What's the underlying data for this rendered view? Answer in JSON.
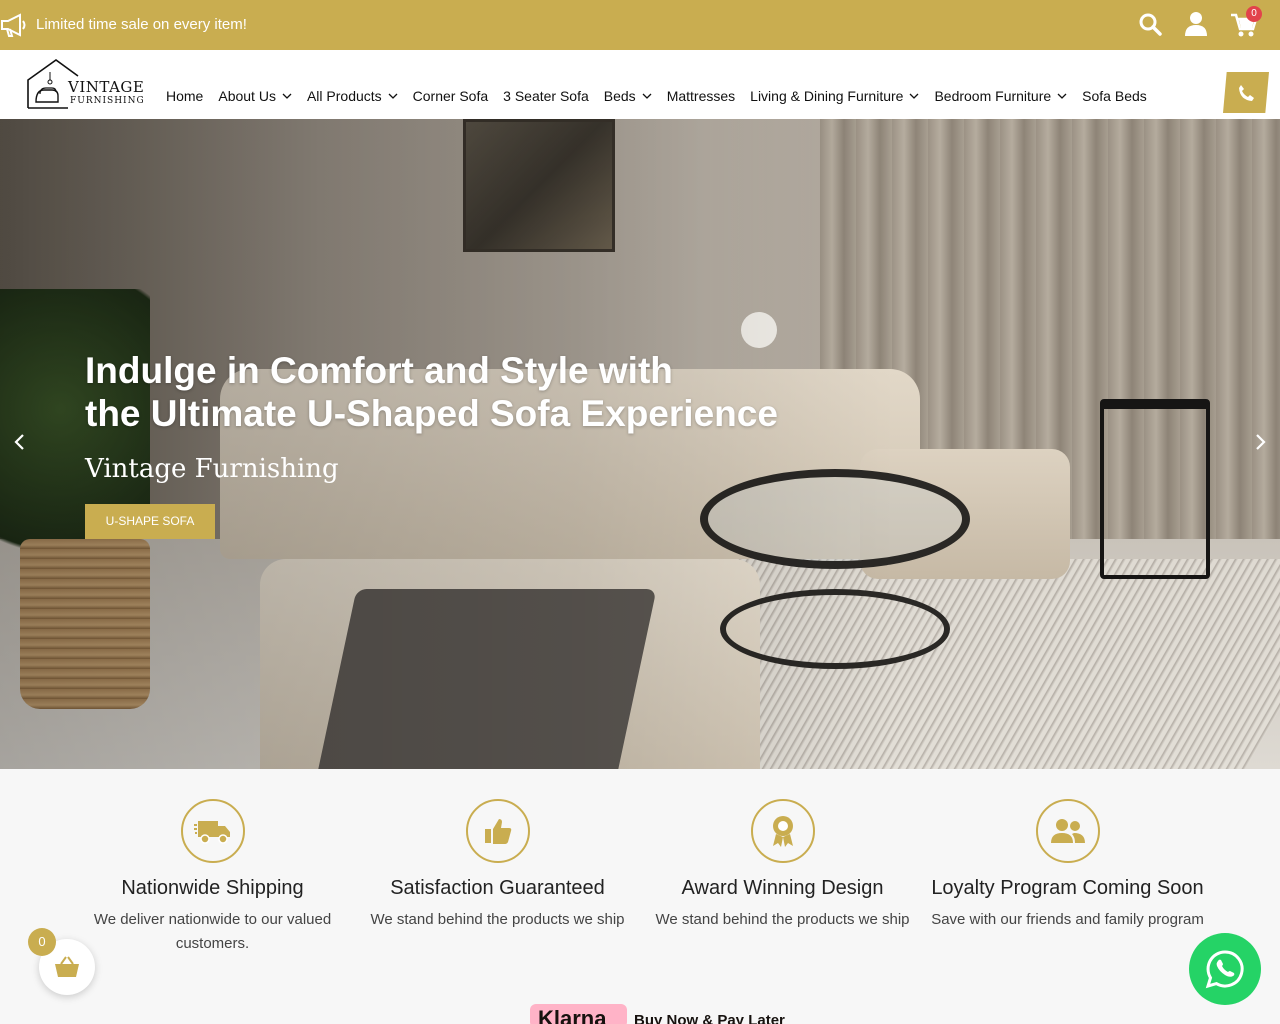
{
  "topbar": {
    "promo_text": "Limited time sale on every item!",
    "cart_count": "0",
    "accent_color": "#c9ad50",
    "icons": [
      "megaphone-icon",
      "search-icon",
      "user-icon",
      "cart-icon"
    ]
  },
  "header": {
    "logo_line1": "VINTAGE",
    "logo_line2": "FURNISHING",
    "nav": [
      {
        "label": "Home",
        "dropdown": false
      },
      {
        "label": "About Us",
        "dropdown": true
      },
      {
        "label": "All Products",
        "dropdown": true
      },
      {
        "label": "Corner Sofa",
        "dropdown": false
      },
      {
        "label": "3 Seater Sofa",
        "dropdown": false
      },
      {
        "label": "Beds",
        "dropdown": true
      },
      {
        "label": "Mattresses",
        "dropdown": false
      },
      {
        "label": "Living & Dining Furniture",
        "dropdown": true
      },
      {
        "label": "Bedroom Furniture",
        "dropdown": true
      },
      {
        "label": "Sofa Beds",
        "dropdown": false
      }
    ]
  },
  "hero": {
    "heading_line1": "Indulge in Comfort and Style with",
    "heading_line2": "the Ultimate U-Shaped Sofa Experience",
    "subtitle": "Vintage Furnishing",
    "button_label": "U-SHAPE SOFA"
  },
  "features": [
    {
      "icon": "truck-icon",
      "title": "Nationwide Shipping",
      "desc": "We deliver nationwide to our valued customers."
    },
    {
      "icon": "thumbs-up-icon",
      "title": "Satisfaction Guaranteed",
      "desc": "We stand behind the products we ship"
    },
    {
      "icon": "award-icon",
      "title": "Award Winning Design",
      "desc": "We stand behind the products we ship"
    },
    {
      "icon": "users-icon",
      "title": "Loyalty Program Coming Soon",
      "desc": "Save with our friends and family program"
    }
  ],
  "payment": {
    "klarna_label": "Klarna",
    "bnpl_text": "Buy Now & Pay Later"
  },
  "floating": {
    "cart_count": "0"
  }
}
